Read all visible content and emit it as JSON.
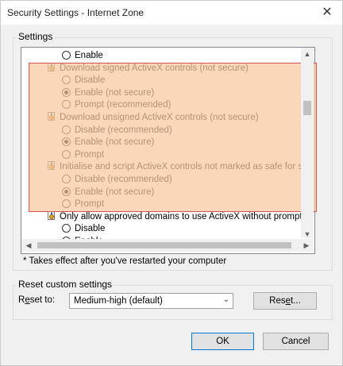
{
  "window": {
    "title": "Security Settings - Internet Zone",
    "close_glyph": "✕"
  },
  "settings_group": {
    "label": "Settings"
  },
  "list_rows": [
    {
      "kind": "option",
      "label": "Enable",
      "checked": false
    },
    {
      "kind": "category",
      "label": "Download signed ActiveX controls (not secure)",
      "icon": "setting-gear-icon"
    },
    {
      "kind": "option",
      "label": "Disable",
      "checked": false
    },
    {
      "kind": "option",
      "label": "Enable (not secure)",
      "checked": true
    },
    {
      "kind": "option",
      "label": "Prompt (recommended)",
      "checked": false
    },
    {
      "kind": "category",
      "label": "Download unsigned ActiveX controls (not secure)",
      "icon": "setting-gear-icon"
    },
    {
      "kind": "option",
      "label": "Disable (recommended)",
      "checked": false
    },
    {
      "kind": "option",
      "label": "Enable (not secure)",
      "checked": true
    },
    {
      "kind": "option",
      "label": "Prompt",
      "checked": false
    },
    {
      "kind": "category",
      "label": "Initialise and script ActiveX controls not marked as safe for sc",
      "icon": "setting-gear-icon"
    },
    {
      "kind": "option",
      "label": "Disable (recommended)",
      "checked": false
    },
    {
      "kind": "option",
      "label": "Enable (not secure)",
      "checked": true
    },
    {
      "kind": "option",
      "label": "Prompt",
      "checked": false
    },
    {
      "kind": "category",
      "label": "Only allow approved domains to use ActiveX without prompt",
      "icon": "setting-gear-icon"
    },
    {
      "kind": "option",
      "label": "Disable",
      "checked": false
    },
    {
      "kind": "option",
      "label": "Enable",
      "checked": true
    }
  ],
  "note": "* Takes effect after you've restarted your computer",
  "reset_group": {
    "label": "Reset custom settings",
    "reset_to_label_pre": "R",
    "reset_to_label_ul": "e",
    "reset_to_label_post": "set to:",
    "selected_level": "Medium-high (default)",
    "reset_button_pre": "Res",
    "reset_button_ul": "e",
    "reset_button_post": "t..."
  },
  "buttons": {
    "ok": "OK",
    "cancel": "Cancel"
  },
  "colors": {
    "highlight_fill": "#fac8a0",
    "highlight_border": "#d9534f",
    "default_button_border": "#0078d7"
  }
}
